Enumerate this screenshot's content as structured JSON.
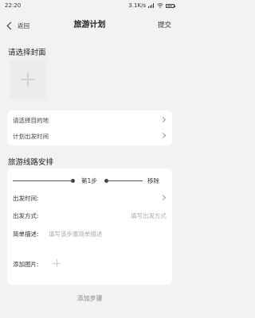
{
  "status_bar": {
    "time": "22:20",
    "net_speed": "3.1K/s"
  },
  "nav": {
    "back_label": "返回",
    "title": "旅游计划",
    "submit_label": "提交"
  },
  "cover": {
    "title": "请选择封面"
  },
  "info": {
    "destination_label": "请选择目的地",
    "departure_time_label": "计划出发时间"
  },
  "route": {
    "title": "旅游线路安排",
    "step_label": "第1步",
    "remove_label": "移除",
    "fields": {
      "departure_time_label": "出发时间:",
      "departure_method_label": "出发方式:",
      "departure_method_placeholder": "填写出发方式",
      "description_label": "简单描述:",
      "description_placeholder": "填写该步骤简单描述",
      "add_picture_label": "添加图片:"
    }
  },
  "add_step_label": "添加步骤",
  "icons": [
    "back-chevron-icon",
    "chevron-right-icon",
    "plus-icon",
    "signal-icon",
    "wifi-icon",
    "battery-icon"
  ]
}
